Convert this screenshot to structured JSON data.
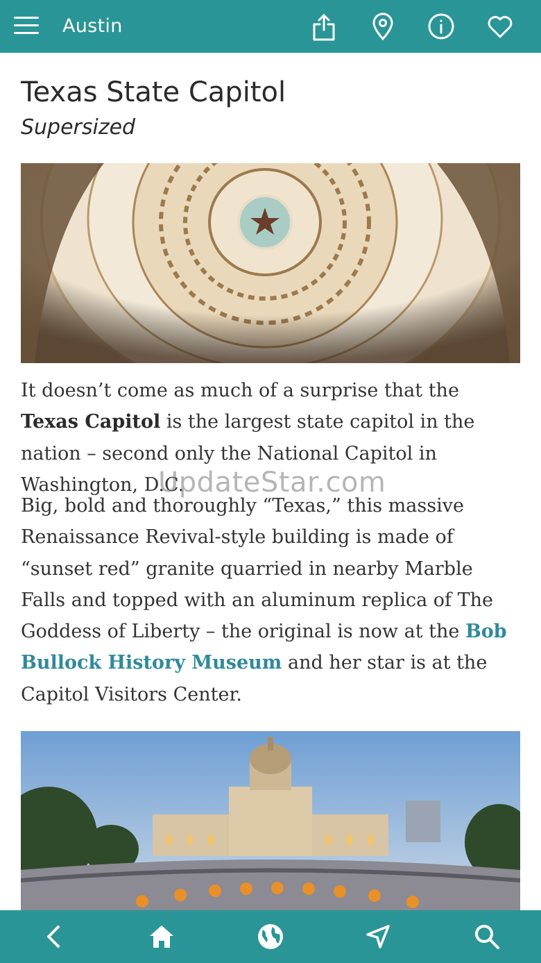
{
  "header": {
    "title": "Austin",
    "icons": [
      "menu-icon",
      "share-icon",
      "location-pin-icon",
      "info-icon",
      "heart-icon"
    ]
  },
  "article": {
    "title": "Texas State Capitol",
    "subtitle": "Supersized",
    "paragraph1": {
      "before": "It doesn’t come as much of a surprise that the ",
      "bold": "Texas Capitol",
      "after": " is the largest state capitol in the nation – second only the National Capitol in Washington, D.C."
    },
    "paragraph2": {
      "before": "Big, bold and thoroughly “Texas,” this massive Renaissance Revival-style building is made of “sunset red” granite quarried in nearby Marble Falls and topped with an aluminum replica of The Goddess of Liberty – the original is now at the ",
      "link": "Bob Bullock History Museum",
      "after": " and her star is at the Capitol Visitors Center."
    }
  },
  "watermark": "UpdateStar.com",
  "footer": {
    "icons": [
      "back-icon",
      "home-icon",
      "globe-icon",
      "navigation-icon",
      "search-icon"
    ]
  },
  "colors": {
    "bar": "#2a9596",
    "link": "#2f8a9c",
    "text": "#333333"
  }
}
